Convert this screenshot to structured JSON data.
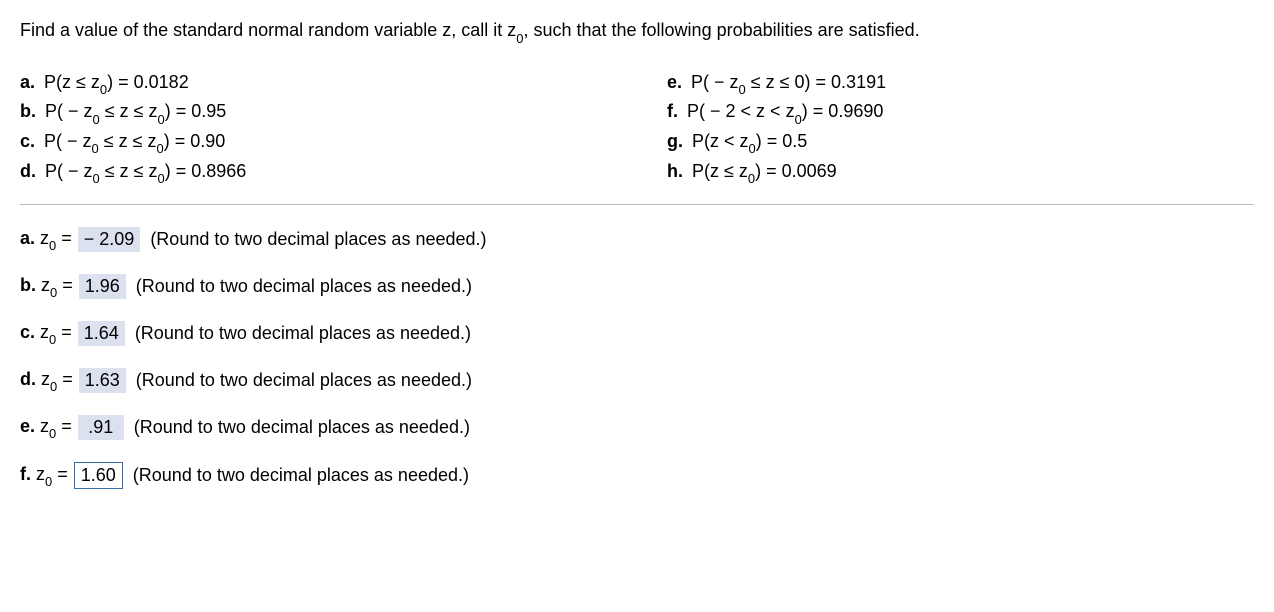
{
  "intro_pre": "Find a value of the standard normal random variable z, call it z",
  "intro_sub": "0",
  "intro_post": ", such that the following probabilities are satisfied.",
  "left": {
    "a": {
      "label": "a.",
      "expr_pre": "P(z ≤ z",
      "expr_post": ") = 0.0182"
    },
    "b": {
      "label": "b.",
      "expr_pre": "P( − z",
      "expr_mid": " ≤ z ≤ z",
      "expr_post": ") = 0.95"
    },
    "c": {
      "label": "c.",
      "expr_pre": "P( − z",
      "expr_mid": " ≤ z ≤ z",
      "expr_post": ") = 0.90"
    },
    "d": {
      "label": "d.",
      "expr_pre": "P( − z",
      "expr_mid": " ≤ z ≤ z",
      "expr_post": ") = 0.8966"
    }
  },
  "right": {
    "e": {
      "label": "e.",
      "expr_pre": "P( − z",
      "expr_post": " ≤ z ≤ 0) = 0.3191"
    },
    "f": {
      "label": "f.",
      "expr_pre": "P( − 2 < z < z",
      "expr_post": ") = 0.9690"
    },
    "g": {
      "label": "g.",
      "expr_pre": "P(z < z",
      "expr_post": ") = 0.5"
    },
    "h": {
      "label": "h.",
      "expr_pre": "P(z ≤ z",
      "expr_post": ") = 0.0069"
    }
  },
  "answers": {
    "a": {
      "label": "a.",
      "var": "z",
      "eq": " = ",
      "value": " − 2.09",
      "hint": "(Round to two decimal places as needed.)",
      "state": "filled"
    },
    "b": {
      "label": "b.",
      "var": "z",
      "eq": " = ",
      "value": "1.96",
      "hint": "(Round to two decimal places as needed.)",
      "state": "filled"
    },
    "c": {
      "label": "c.",
      "var": "z",
      "eq": " = ",
      "value": "1.64",
      "hint": "(Round to two decimal places as needed.)",
      "state": "filled"
    },
    "d": {
      "label": "d.",
      "var": "z",
      "eq": " = ",
      "value": "1.63",
      "hint": "(Round to two decimal places as needed.)",
      "state": "filled"
    },
    "e": {
      "label": "e.",
      "var": "z",
      "eq": " = ",
      "value": ".91",
      "hint": "(Round to two decimal places as needed.)",
      "state": "filled"
    },
    "f": {
      "label": "f.",
      "var": "z",
      "eq": " = ",
      "value": "1.60",
      "hint": "(Round to two decimal places as needed.)",
      "state": "active"
    }
  },
  "sub0": "0"
}
